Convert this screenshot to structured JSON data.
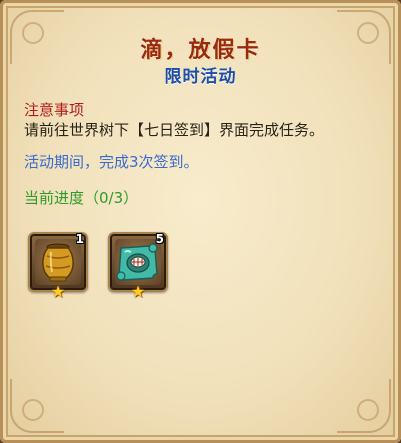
{
  "header": {
    "title": "滴，放假卡",
    "subtitle": "限时活动"
  },
  "notice": {
    "heading": "注意事项",
    "body": "请前往世界树下【七日签到】界面完成任务。"
  },
  "period_text": "活动期间，完成3次签到。",
  "progress_text": "当前进度（0/3）",
  "rewards": [
    {
      "icon": "golden-urn-icon",
      "count": "1",
      "stars": 1
    },
    {
      "icon": "teal-puzzle-chest-icon",
      "count": "5",
      "stars": 1
    }
  ],
  "colors": {
    "title": "#9a2a0e",
    "subtitle": "#1d4fa8",
    "notice_heading": "#b11c1c",
    "period": "#3a6ad0",
    "progress": "#2f9a2a",
    "star": "#ffcc2a"
  }
}
